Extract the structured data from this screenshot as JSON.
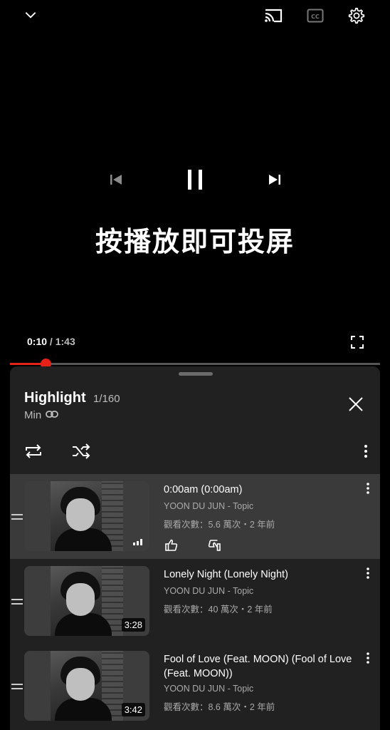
{
  "player": {
    "cast_overlay_text": "按播放即可投屏",
    "current_time": "0:10",
    "time_separator": " / ",
    "duration": "1:43",
    "progress_fraction": 0.097,
    "accent_color": "#e62117",
    "icons": [
      "chevron-down-icon",
      "cast-icon",
      "captions-icon",
      "settings-icon",
      "previous-icon",
      "pause-icon",
      "next-icon",
      "fullscreen-icon"
    ]
  },
  "playlist": {
    "title": "Highlight",
    "position": "1/160",
    "owner": "Min",
    "icons": [
      "link-icon",
      "close-icon",
      "loop-icon",
      "shuffle-icon",
      "more-vert-icon"
    ]
  },
  "videos": [
    {
      "title": "0:00am (0:00am)",
      "channel": "YOON DU JUN - Topic",
      "meta": "觀看次數：5.6 萬次・2 年前",
      "duration": "",
      "now_playing": true
    },
    {
      "title": "Lonely Night (Lonely Night)",
      "channel": "YOON DU JUN - Topic",
      "meta": "觀看次數：40 萬次・2 年前",
      "duration": "3:28",
      "now_playing": false
    },
    {
      "title": "Fool of Love (Feat. MOON) (Fool of Love (Feat. MOON))",
      "channel": "YOON DU JUN - Topic",
      "meta": "觀看次數：8.6 萬次・2 年前",
      "duration": "3:42",
      "now_playing": false
    }
  ]
}
